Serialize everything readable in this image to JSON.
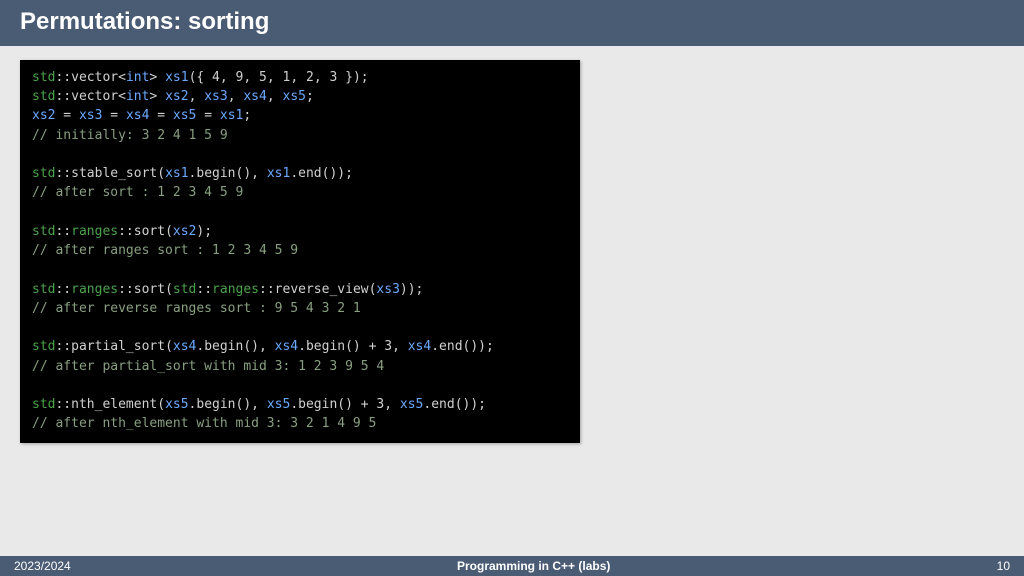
{
  "header": {
    "title": "Permutations: sorting"
  },
  "footer": {
    "year": "2023/2024",
    "course": "Programming in C++ (labs)",
    "page": "10"
  },
  "code": {
    "lines": [
      [
        [
          "ns",
          "std"
        ],
        [
          "punc",
          "::"
        ],
        [
          "func",
          "vector"
        ],
        [
          "punc",
          "<"
        ],
        [
          "type",
          "int"
        ],
        [
          "punc",
          "> "
        ],
        [
          "id",
          "xs1"
        ],
        [
          "punc",
          "({ "
        ],
        [
          "num",
          "4"
        ],
        [
          "punc",
          ", "
        ],
        [
          "num",
          "9"
        ],
        [
          "punc",
          ", "
        ],
        [
          "num",
          "5"
        ],
        [
          "punc",
          ", "
        ],
        [
          "num",
          "1"
        ],
        [
          "punc",
          ", "
        ],
        [
          "num",
          "2"
        ],
        [
          "punc",
          ", "
        ],
        [
          "num",
          "3"
        ],
        [
          "punc",
          " });"
        ]
      ],
      [
        [
          "ns",
          "std"
        ],
        [
          "punc",
          "::"
        ],
        [
          "func",
          "vector"
        ],
        [
          "punc",
          "<"
        ],
        [
          "type",
          "int"
        ],
        [
          "punc",
          "> "
        ],
        [
          "id",
          "xs2"
        ],
        [
          "punc",
          ", "
        ],
        [
          "id",
          "xs3"
        ],
        [
          "punc",
          ", "
        ],
        [
          "id",
          "xs4"
        ],
        [
          "punc",
          ", "
        ],
        [
          "id",
          "xs5"
        ],
        [
          "punc",
          ";"
        ]
      ],
      [
        [
          "id",
          "xs2"
        ],
        [
          "punc",
          " = "
        ],
        [
          "id",
          "xs3"
        ],
        [
          "punc",
          " = "
        ],
        [
          "id",
          "xs4"
        ],
        [
          "punc",
          " = "
        ],
        [
          "id",
          "xs5"
        ],
        [
          "punc",
          " = "
        ],
        [
          "id",
          "xs1"
        ],
        [
          "punc",
          ";"
        ]
      ],
      [
        [
          "cmt",
          "// initially: 3 2 4 1 5 9"
        ]
      ],
      [],
      [
        [
          "ns",
          "std"
        ],
        [
          "punc",
          "::"
        ],
        [
          "func",
          "stable_sort"
        ],
        [
          "punc",
          "("
        ],
        [
          "id",
          "xs1"
        ],
        [
          "punc",
          "."
        ],
        [
          "func",
          "begin"
        ],
        [
          "punc",
          "(), "
        ],
        [
          "id",
          "xs1"
        ],
        [
          "punc",
          "."
        ],
        [
          "func",
          "end"
        ],
        [
          "punc",
          "());"
        ]
      ],
      [
        [
          "cmt",
          "// after sort : 1 2 3 4 5 9"
        ]
      ],
      [],
      [
        [
          "ns",
          "std"
        ],
        [
          "punc",
          "::"
        ],
        [
          "ns",
          "ranges"
        ],
        [
          "punc",
          "::"
        ],
        [
          "func",
          "sort"
        ],
        [
          "punc",
          "("
        ],
        [
          "id",
          "xs2"
        ],
        [
          "punc",
          ");"
        ]
      ],
      [
        [
          "cmt",
          "// after ranges sort : 1 2 3 4 5 9"
        ]
      ],
      [],
      [
        [
          "ns",
          "std"
        ],
        [
          "punc",
          "::"
        ],
        [
          "ns",
          "ranges"
        ],
        [
          "punc",
          "::"
        ],
        [
          "func",
          "sort"
        ],
        [
          "punc",
          "("
        ],
        [
          "ns",
          "std"
        ],
        [
          "punc",
          "::"
        ],
        [
          "ns",
          "ranges"
        ],
        [
          "punc",
          "::"
        ],
        [
          "func",
          "reverse_view"
        ],
        [
          "punc",
          "("
        ],
        [
          "id",
          "xs3"
        ],
        [
          "punc",
          "));"
        ]
      ],
      [
        [
          "cmt",
          "// after reverse ranges sort : 9 5 4 3 2 1"
        ]
      ],
      [],
      [
        [
          "ns",
          "std"
        ],
        [
          "punc",
          "::"
        ],
        [
          "func",
          "partial_sort"
        ],
        [
          "punc",
          "("
        ],
        [
          "id",
          "xs4"
        ],
        [
          "punc",
          "."
        ],
        [
          "func",
          "begin"
        ],
        [
          "punc",
          "(), "
        ],
        [
          "id",
          "xs4"
        ],
        [
          "punc",
          "."
        ],
        [
          "func",
          "begin"
        ],
        [
          "punc",
          "() + "
        ],
        [
          "num",
          "3"
        ],
        [
          "punc",
          ", "
        ],
        [
          "id",
          "xs4"
        ],
        [
          "punc",
          "."
        ],
        [
          "func",
          "end"
        ],
        [
          "punc",
          "());"
        ]
      ],
      [
        [
          "cmt",
          "// after partial_sort with mid 3: 1 2 3 9 5 4"
        ]
      ],
      [],
      [
        [
          "ns",
          "std"
        ],
        [
          "punc",
          "::"
        ],
        [
          "func",
          "nth_element"
        ],
        [
          "punc",
          "("
        ],
        [
          "id",
          "xs5"
        ],
        [
          "punc",
          "."
        ],
        [
          "func",
          "begin"
        ],
        [
          "punc",
          "(), "
        ],
        [
          "id",
          "xs5"
        ],
        [
          "punc",
          "."
        ],
        [
          "func",
          "begin"
        ],
        [
          "punc",
          "() + "
        ],
        [
          "num",
          "3"
        ],
        [
          "punc",
          ", "
        ],
        [
          "id",
          "xs5"
        ],
        [
          "punc",
          "."
        ],
        [
          "func",
          "end"
        ],
        [
          "punc",
          "());"
        ]
      ],
      [
        [
          "cmt",
          "// after nth_element with mid 3: 3 2 1 4 9 5"
        ]
      ]
    ]
  }
}
